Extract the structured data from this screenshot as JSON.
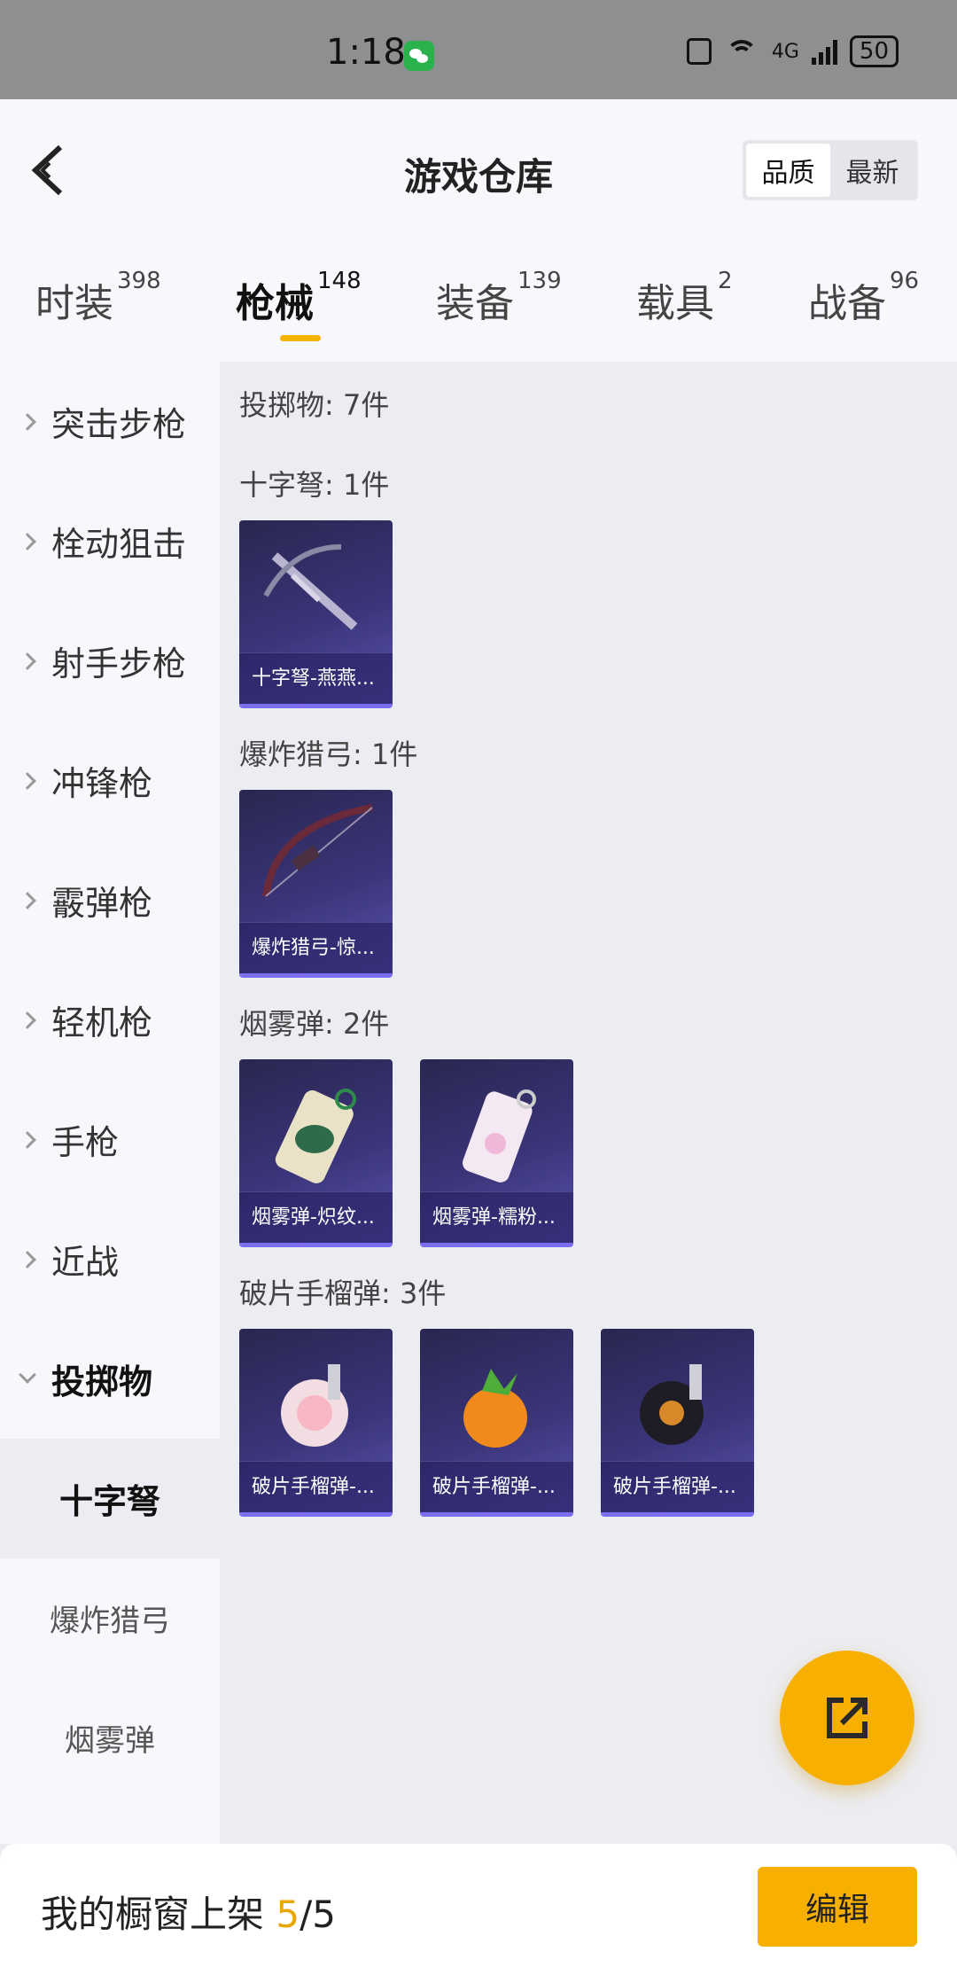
{
  "status": {
    "time": "1:18",
    "network": "4G",
    "battery": "50",
    "wechat_icon": "wechat-icon"
  },
  "header": {
    "title": "游戏仓库",
    "sort": [
      "品质",
      "最新"
    ]
  },
  "tabs": [
    {
      "label": "时装",
      "count": "398"
    },
    {
      "label": "枪械",
      "count": "148"
    },
    {
      "label": "装备",
      "count": "139"
    },
    {
      "label": "载具",
      "count": "2"
    },
    {
      "label": "战备",
      "count": "96"
    }
  ],
  "sidebar": {
    "categories": [
      "突击步枪",
      "栓动狙击",
      "射手步枪",
      "冲锋枪",
      "霰弹枪",
      "轻机枪",
      "手枪",
      "近战",
      "投掷物"
    ],
    "subitems": [
      "十字弩",
      "爆炸猎弓",
      "烟雾弹"
    ]
  },
  "content": {
    "summary": "投掷物: 7件",
    "sections": [
      {
        "label": "十字弩: 1件",
        "items": [
          "十字弩-燕燕..."
        ]
      },
      {
        "label": "爆炸猎弓: 1件",
        "items": [
          "爆炸猎弓-惊..."
        ]
      },
      {
        "label": "烟雾弹: 2件",
        "items": [
          "烟雾弹-炽纹...",
          "烟雾弹-糯粉..."
        ]
      },
      {
        "label": "破片手榴弹: 3件",
        "items": [
          "破片手榴弹-...",
          "破片手榴弹-...",
          "破片手榴弹-..."
        ]
      }
    ]
  },
  "bottom": {
    "label": "我的橱窗上架 ",
    "count": "5",
    "total": "/5",
    "edit": "编辑"
  },
  "colors": {
    "accent": "#f8b000",
    "card_bg": "#3a3579"
  }
}
